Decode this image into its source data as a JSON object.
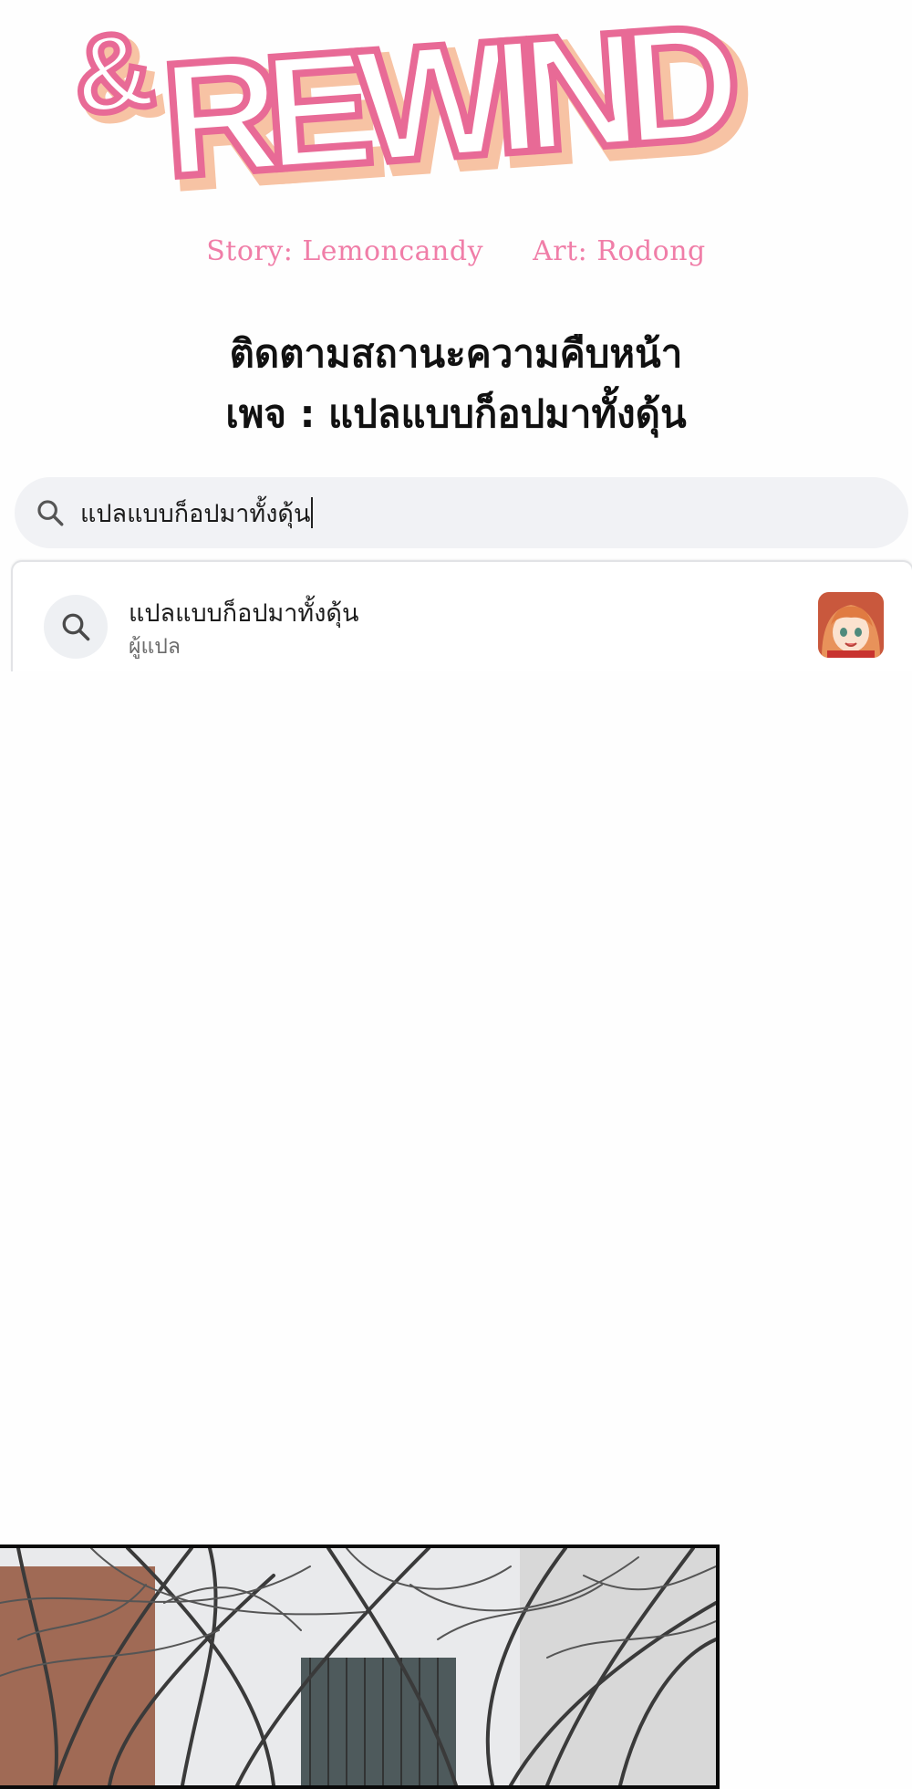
{
  "logo": {
    "ampersand": "&",
    "title": "REWIND",
    "colors": {
      "fill": "#ffffff",
      "outline": "#e86a96",
      "shadow": "#f7c3a4"
    }
  },
  "credits": {
    "story": "Story: Lemoncandy",
    "art": "Art: Rodong",
    "color": "#f07ea8"
  },
  "notice": {
    "line1": "ติดตามสถานะความคืบหน้า",
    "line2": "เพจ : แปลแบบก็อปมาทั้งดุ้น"
  },
  "search": {
    "icon": "search-icon",
    "value": "แปลแบบก็อปมาทั้งดุ้น"
  },
  "results": [
    {
      "icon": "search-icon",
      "title": "แปลแบบก็อปมาทั้งดุ้น",
      "subtitle": "ผู้แปล",
      "avatar": "anime-girl-avatar"
    }
  ],
  "comic_panel": {
    "description_icon": "bare-trees-illustration"
  }
}
